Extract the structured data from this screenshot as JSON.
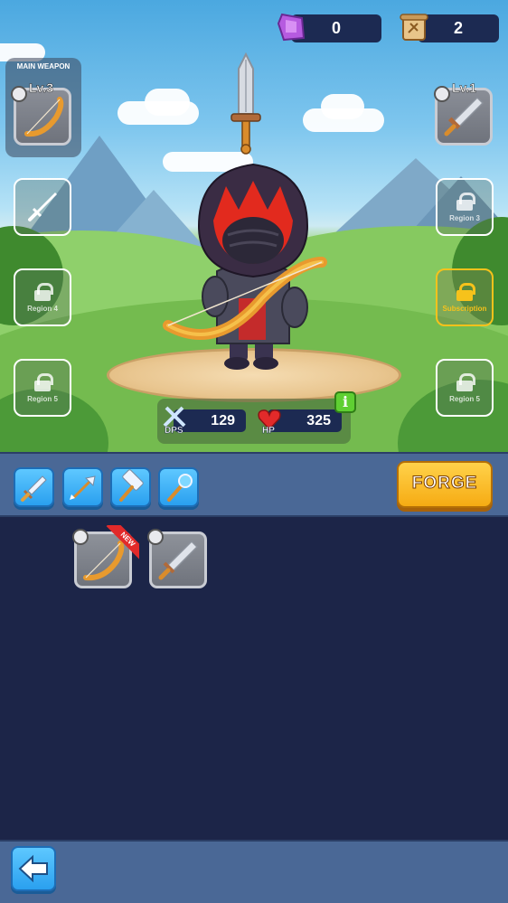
{
  "currency": {
    "gems": "0",
    "scrolls": "2"
  },
  "main_weapon": {
    "title": "MAIN WEAPON",
    "level": "Lv.3"
  },
  "secondary_weapon": {
    "level": "Lv.1"
  },
  "slots": {
    "region_4": "Region 4",
    "region_5_left": "Region 5",
    "region_3": "Region 3",
    "subscription": "Subscription",
    "region_5_right": "Region 5"
  },
  "stats": {
    "dps_label": "DPS",
    "dps_value": "129",
    "hp_label": "HP",
    "hp_value": "325",
    "info": "i"
  },
  "toolbar": {
    "forge_label": "FORGE",
    "categories": [
      "sword-icon",
      "arrow-icon",
      "hammer-icon",
      "staff-icon"
    ]
  },
  "inventory": {
    "items": [
      {
        "icon": "bow-icon",
        "new_label": "NEW"
      },
      {
        "icon": "sword-icon"
      }
    ]
  },
  "colors": {
    "panel": "#4a6896",
    "background": "#1c2548",
    "forge": "#f6ab13",
    "accent_blue": "#2aa0ef",
    "subscription": "#f6c21b"
  }
}
